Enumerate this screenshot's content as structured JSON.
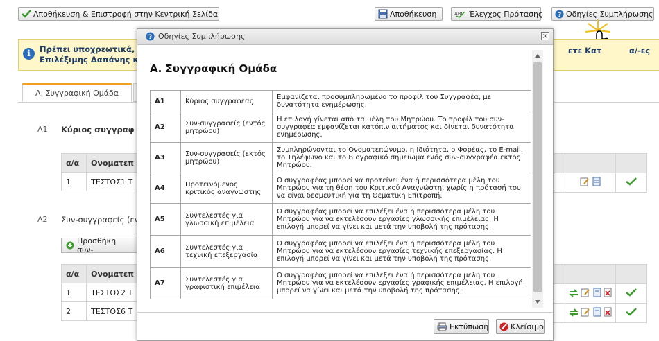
{
  "toolbar": {
    "save_return_label": "Αποθήκευση & Επιστροφή στην Κεντρική Σελίδα",
    "save_label": "Αποθήκευση",
    "check_label": "Έλεγχος Πρότασης",
    "guide_label": "Οδηγίες Συμπλήρωσης"
  },
  "alert": {
    "line1": "Πρέπει υποχρεωτικά,",
    "line2": "Επιλέξιμης Δαπάνης κ",
    "right": "ετε Κατ",
    "right2": "α/-ες"
  },
  "tabs": {
    "active": "Α. Συγγραφική Ομάδα"
  },
  "sections": {
    "a1": {
      "code": "A1",
      "title": "Κύριος συγγραφ"
    },
    "a2": {
      "code": "A2",
      "title": "Συν-συγγραφείς (εν"
    }
  },
  "table_a1": {
    "headers": [
      "α/α",
      "Ονοματεπ"
    ],
    "rows": [
      {
        "num": "1",
        "name": "ΤΕΣΤΟΣ1 Τ"
      }
    ]
  },
  "add_button_label": "Προσθήκη συν-",
  "table_a2": {
    "headers": [
      "α/α",
      "Ονοματεπ"
    ],
    "rows": [
      {
        "num": "1",
        "name": "ΤΕΣΤΟΣ2 Τ"
      },
      {
        "num": "2",
        "name": "ΤΕΣΤΟΣ6 Τ"
      }
    ]
  },
  "dialog": {
    "title": "Οδηγίες Συμπλήρωσης",
    "heading": "Α. Συγγραφική Ομάδα",
    "rows": [
      {
        "code": "A1",
        "label": "Κύριος συγγραφέας",
        "desc": "Εμφανίζεται προσυμπληρωμένο το προφίλ του Συγγραφέα, με δυνατότητα ενημέρωσης."
      },
      {
        "code": "A2",
        "label": "Συν-συγγραφείς (εντός μητρώου)",
        "desc": "Η επιλογή γίνεται από τα μέλη του Μητρώου. Το προφίλ του συν-συγγραφέα εμφανίζεται κατόπιν αιτήματος και δίνεται δυνατότητα ενημέρωσης."
      },
      {
        "code": "A3",
        "label": "Συν-συγγραφείς (εκτός μητρώου)",
        "desc": "Συμπληρώνονται το Ονοματεπώνυμο, η Ιδιότητα, ο Φορέας, το E-mail, το Τηλέφωνο και το Βιογραφικό σημείωμα ενός συν-συγγραφέα εκτός Μητρώου."
      },
      {
        "code": "A4",
        "label": "Προτεινόμενος κριτικός αναγνώστης",
        "desc": "Ο συγγραφέας μπορεί να προτείνει ένα ή περισσότερα μέλη του Μητρώου για τη θέση του Κριτικού Αναγνώστη, χωρίς η πρότασή του να είναι δεσμευτική για τη Θεματική Επιτροπή."
      },
      {
        "code": "A5",
        "label": "Συντελεστές για γλωσσική επιμέλεια",
        "desc": "Ο συγγραφέας μπορεί να επιλέξει ένα ή περισσότερα μέλη του Μητρώου για να εκτελέσουν εργασίες γλωσσικής επιμέλειας. Η επιλογή μπορεί να γίνει και μετά την υποβολή της πρότασης."
      },
      {
        "code": "A6",
        "label": "Συντελεστές για τεχνική επεξεργασία",
        "desc": "Ο συγγραφέας μπορεί να επιλέξει ένα ή περισσότερα μέλη του Μητρώου για να εκτελέσουν εργασίες τεχνικής επεξεργασίας. Η επιλογή μπορεί να γίνει και μετά την υποβολή της πρότασης."
      },
      {
        "code": "A7",
        "label": "Συντελεστές για γραφιστική επιμέλεια",
        "desc": "Ο συγγραφέας μπορεί να επιλέξει ένα ή περισσότερα μέλη του Μητρώου για να εκτελέσουν εργασίες γραφικής επιμέλειας. Η επιλογή μπορεί να γίνει και μετά την υποβολή της πρότασης."
      }
    ],
    "print_label": "Εκτύπωση",
    "close_label": "Κλείσιμο",
    "close_x": "×"
  },
  "colors": {
    "accent": "#f0a020",
    "alert_bg": "#fff7c9",
    "ok_green": "#3a9a2a",
    "link_blue": "#2a6ebb"
  }
}
